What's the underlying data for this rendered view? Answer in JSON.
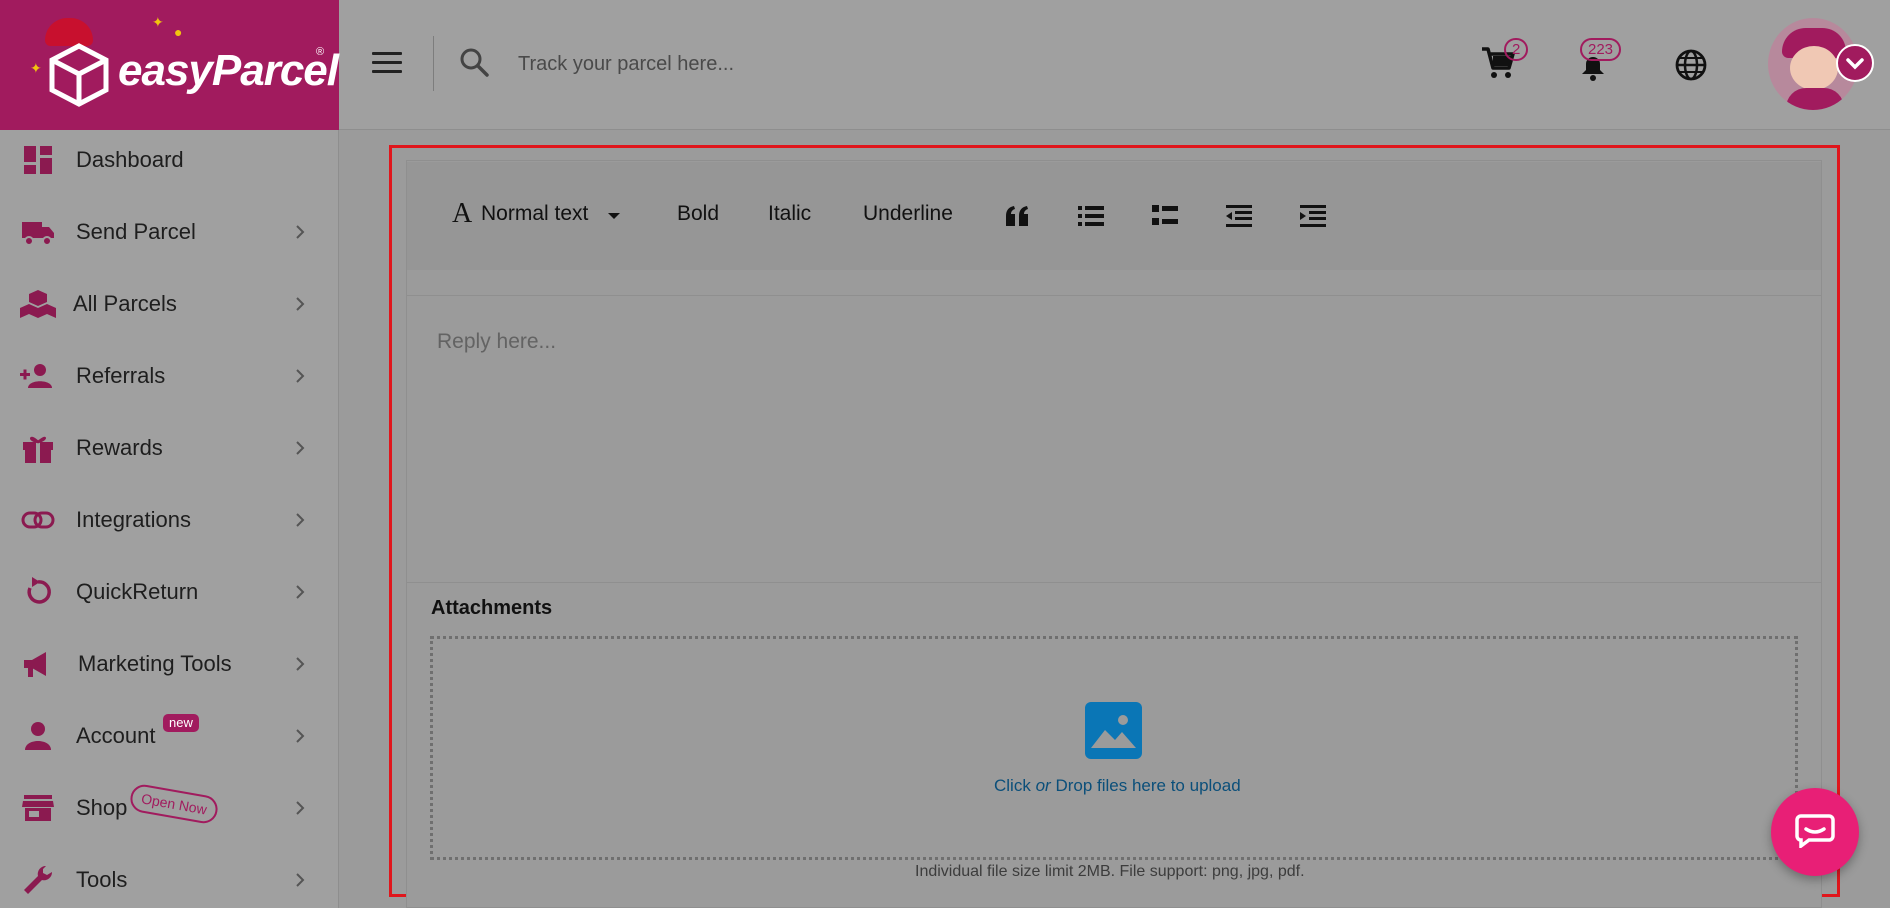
{
  "logo": {
    "brand": "easyParcel",
    "reg": "®"
  },
  "header": {
    "search_placeholder": "Track your parcel here...",
    "cart_count": "2",
    "notification_count": "223"
  },
  "sidebar": {
    "items": [
      {
        "label": "Dashboard",
        "icon": "dashboard-icon",
        "has_chevron": false
      },
      {
        "label": "Send Parcel",
        "icon": "truck-icon",
        "has_chevron": true
      },
      {
        "label": "All Parcels",
        "icon": "boxes-icon",
        "has_chevron": true
      },
      {
        "label": "Referrals",
        "icon": "add-user-icon",
        "has_chevron": true
      },
      {
        "label": "Rewards",
        "icon": "gift-icon",
        "has_chevron": true
      },
      {
        "label": "Integrations",
        "icon": "link-icon",
        "has_chevron": true
      },
      {
        "label": "QuickReturn",
        "icon": "return-icon",
        "has_chevron": true
      },
      {
        "label": "Marketing Tools",
        "icon": "megaphone-icon",
        "has_chevron": true
      },
      {
        "label": "Account",
        "icon": "user-icon",
        "has_chevron": true,
        "tag": "new"
      },
      {
        "label": "Shop",
        "icon": "store-icon",
        "has_chevron": true,
        "tag": "Open Now"
      },
      {
        "label": "Tools",
        "icon": "wrench-icon",
        "has_chevron": true
      }
    ]
  },
  "editor": {
    "toolbar": {
      "format_label": "Normal text",
      "bold_label": "Bold",
      "italic_label": "Italic",
      "underline_label": "Underline"
    },
    "reply_placeholder": "Reply here...",
    "attachments_title": "Attachments",
    "dropzone": {
      "click": "Click",
      "or": "or",
      "drop": "Drop files here to upload"
    },
    "file_note": "Individual file size limit 2MB. File support: png, jpg, pdf."
  },
  "colors": {
    "brand": "#a11b5e",
    "highlight": "#e0161c",
    "link": "#0b4f7a",
    "chat": "#e81f76"
  }
}
